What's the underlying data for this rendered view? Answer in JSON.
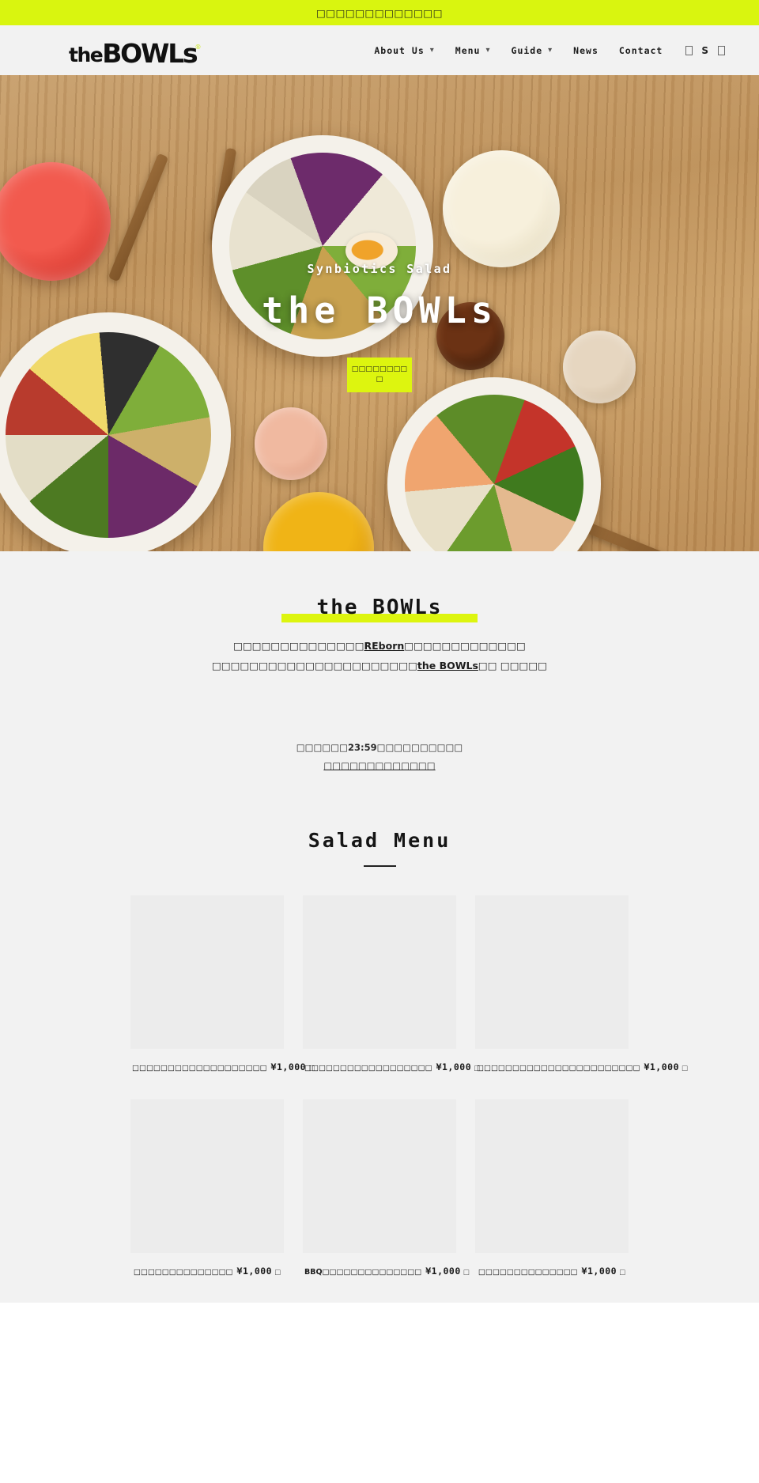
{
  "announcement": {
    "text": "□□□□□□□□□□□□□"
  },
  "header": {
    "logo": {
      "the": "the",
      "mark": "BOWLs",
      "tm": "®"
    },
    "nav": [
      {
        "label": "About Us",
        "has_dropdown": true
      },
      {
        "label": "Menu",
        "has_dropdown": true
      },
      {
        "label": "Guide",
        "has_dropdown": true
      },
      {
        "label": "News",
        "has_dropdown": false
      },
      {
        "label": "Contact",
        "has_dropdown": false
      }
    ],
    "icons": [
      {
        "name": "search-icon",
        "glyph": "□"
      },
      {
        "name": "account-icon",
        "glyph": "S"
      },
      {
        "name": "cart-icon",
        "glyph": "□"
      }
    ]
  },
  "hero": {
    "subtitle": "Synbiotics Salad",
    "title": "the BOWLs",
    "cta_line1": "□□□□□□□□",
    "cta_line2": "□"
  },
  "about": {
    "title": "the BOWLs",
    "paragraph_line1_pre": "□□□□□□□□□□□□□□",
    "paragraph_line1_link": "REborn",
    "paragraph_line1_post": "□□□□□□□□□□□□□",
    "paragraph_line2_pre": "□□□□□□□□□□□□□□□□□□□□□□",
    "paragraph_line2_link": "the BOWLs",
    "paragraph_line2_post": "□□ □□□□□",
    "hours_pre": "□□□□□□",
    "hours_time": "23:59",
    "hours_post": "□□□□□□□□□□",
    "hours_link": "□□□□□□□□□□□□□"
  },
  "menu": {
    "title": "Salad Menu",
    "items": [
      {
        "name": "□□□□□□□□□□□□□□□□□□□",
        "price": "¥1,000",
        "suffix": "□"
      },
      {
        "name": "□□□□□□□□□□□□□□□□□□",
        "price": "¥1,000",
        "suffix": "□"
      },
      {
        "name": "□□□□□□□□□□□□□□□□□□□□□□□",
        "price": "¥1,000",
        "suffix": "□"
      },
      {
        "name": "□□□□□□□□□□□□□□",
        "price": "¥1,000",
        "suffix": "□"
      },
      {
        "name": "BBQ□□□□□□□□□□□□□□",
        "price": "¥1,000",
        "suffix": "□"
      },
      {
        "name": "□□□□□□□□□□□□□□",
        "price": "¥1,000",
        "suffix": "□"
      }
    ]
  },
  "colors": {
    "accent_yellow": "#ddf50f",
    "banner_yellow": "#d9f50f",
    "page_bg": "#f2f2f2",
    "text_dark": "#1a1a1a"
  }
}
